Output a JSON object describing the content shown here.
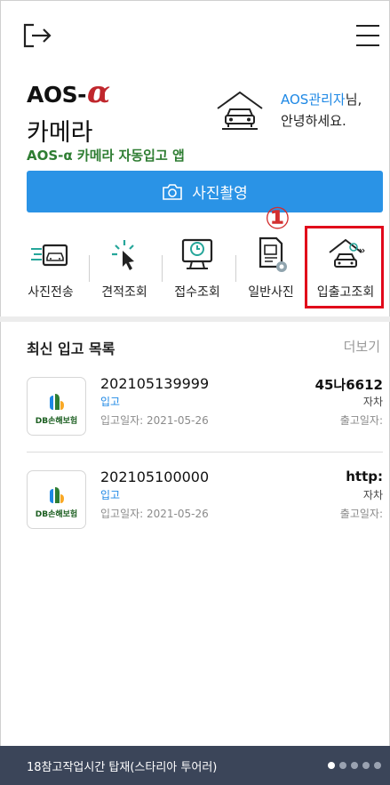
{
  "brand": {
    "name_prefix": "AOS-",
    "alpha": "α",
    "name_line2": "카메라",
    "subtitle": "AOS-α 카메라 자동입고 앱"
  },
  "greeting": {
    "name": "AOS관리자",
    "suffix": "님,",
    "line2": "안녕하세요."
  },
  "photo_button": {
    "label": "사진촬영"
  },
  "marker": "①",
  "quick_menu": [
    {
      "label": "사진전송",
      "icon": "photo-send-icon"
    },
    {
      "label": "견적조회",
      "icon": "cursor-click-icon"
    },
    {
      "label": "접수조회",
      "icon": "monitor-clock-icon"
    },
    {
      "label": "일반사진",
      "icon": "document-icon"
    },
    {
      "label": "입출고조회",
      "icon": "garage-car-icon"
    }
  ],
  "list": {
    "title": "최신 입고 목록",
    "more": "더보기",
    "items": [
      {
        "number": "202105139999",
        "status": "입고",
        "in_date": "입고일자: 2021-05-26",
        "plate": "45나6612",
        "type": "자차",
        "out_date": "출고일자:",
        "logo_text": "DB손해보험"
      },
      {
        "number": "202105100000",
        "status": "입고",
        "in_date": "입고일자: 2021-05-26",
        "plate": "http:",
        "type": "자차",
        "out_date": "출고일자:",
        "logo_text": "DB손해보험"
      }
    ]
  },
  "footer": {
    "text": "18참고작업시간 탑재(스타리아 투어러)",
    "page_count": 5,
    "active_page": 1
  },
  "colors": {
    "accent_blue": "#2a93e6",
    "brand_green": "#2e7d32",
    "alpha_red": "#c0272d",
    "highlight_red": "#e1091b",
    "footer_bg": "#3b4559"
  }
}
